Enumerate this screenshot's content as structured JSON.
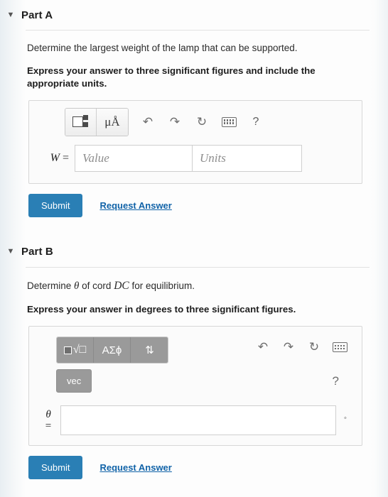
{
  "part_a": {
    "caret": "▼",
    "title": "Part A",
    "prompt": "Determine the largest weight of the lamp that can be supported.",
    "instruction": "Express your answer to three significant figures and include the appropriate units.",
    "toolbar": {
      "template_icon": "math-template-icon",
      "units_icon": "μÅ",
      "undo_icon": "↶",
      "redo_icon": "↷",
      "reset_icon": "↻",
      "keyboard_icon": "keyboard-icon",
      "help_icon": "?"
    },
    "field": {
      "label": "W =",
      "value": "",
      "value_placeholder": "Value",
      "units": "",
      "units_placeholder": "Units"
    },
    "submit_label": "Submit",
    "request_answer_label": "Request Answer"
  },
  "part_b": {
    "caret": "▼",
    "title": "Part B",
    "prompt_pre": "Determine ",
    "prompt_theta": "θ",
    "prompt_mid": " of cord ",
    "prompt_cord": "DC",
    "prompt_post": " for equilibrium.",
    "instruction": "Express your answer in degrees to three significant figures.",
    "toolbar": {
      "sqrt_label": "√□",
      "greek_label": "ΑΣϕ",
      "updown_label": "⇅",
      "vec_label": "vec",
      "undo_icon": "↶",
      "redo_icon": "↷",
      "reset_icon": "↻",
      "keyboard_icon": "keyboard-icon",
      "help_icon": "?"
    },
    "field": {
      "label_symbol": "θ",
      "label_equals": "=",
      "value": "",
      "unit_suffix": "◦"
    },
    "submit_label": "Submit",
    "request_answer_label": "Request Answer"
  },
  "colors": {
    "submit_blue": "#2a7fb5",
    "link_blue": "#1163a8",
    "toolbar_gray": "#9a9a9a"
  }
}
